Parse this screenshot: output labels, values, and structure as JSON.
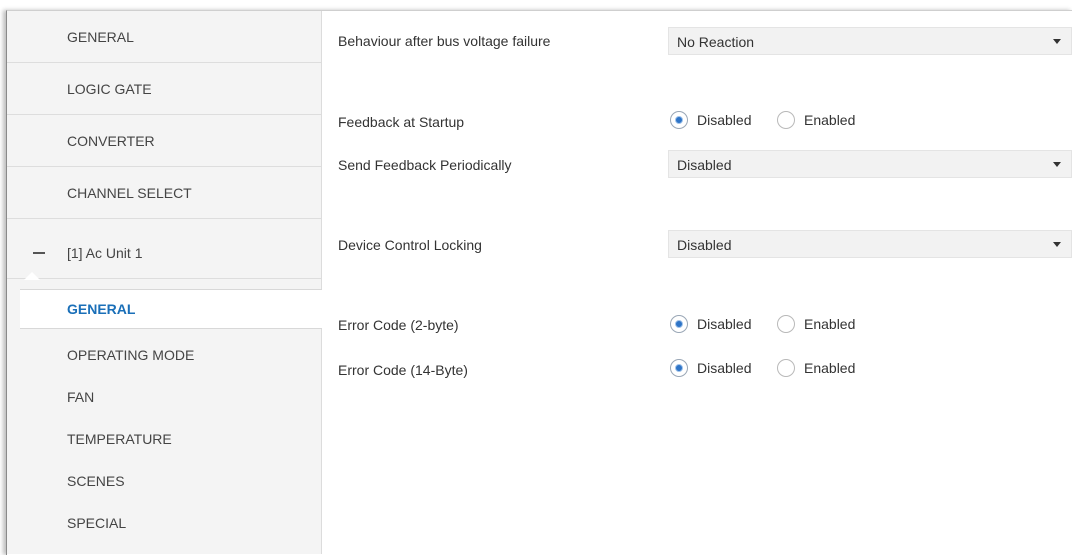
{
  "sidebar": {
    "items": [
      {
        "label": "GENERAL"
      },
      {
        "label": "LOGIC GATE"
      },
      {
        "label": "CONVERTER"
      },
      {
        "label": "CHANNEL SELECT"
      },
      {
        "label": "[1] Ac Unit 1",
        "collapse_icon": "minus-icon"
      }
    ],
    "sub_items": [
      {
        "label": "GENERAL",
        "active": true
      },
      {
        "label": "OPERATING MODE"
      },
      {
        "label": "FAN"
      },
      {
        "label": "TEMPERATURE"
      },
      {
        "label": "SCENES"
      },
      {
        "label": "SPECIAL"
      }
    ]
  },
  "main": {
    "bus_failure": {
      "label": "Behaviour after bus voltage failure",
      "value": "No Reaction"
    },
    "feedback_startup": {
      "label": "Feedback at Startup",
      "options": [
        "Disabled",
        "Enabled"
      ],
      "selected": "Disabled"
    },
    "feedback_periodic": {
      "label": "Send Feedback Periodically",
      "value": "Disabled"
    },
    "device_lock": {
      "label": "Device Control Locking",
      "value": "Disabled"
    },
    "error_2byte": {
      "label": "Error Code (2-byte)",
      "options": [
        "Disabled",
        "Enabled"
      ],
      "selected": "Disabled"
    },
    "error_14byte": {
      "label": "Error Code (14-Byte)",
      "options": [
        "Disabled",
        "Enabled"
      ],
      "selected": "Disabled"
    }
  },
  "colors": {
    "accent": "#1a6fb8",
    "radio_selected": "#2e74c7",
    "sidebar_bg": "#f4f4f4",
    "dropdown_bg": "#f2f2f2"
  }
}
